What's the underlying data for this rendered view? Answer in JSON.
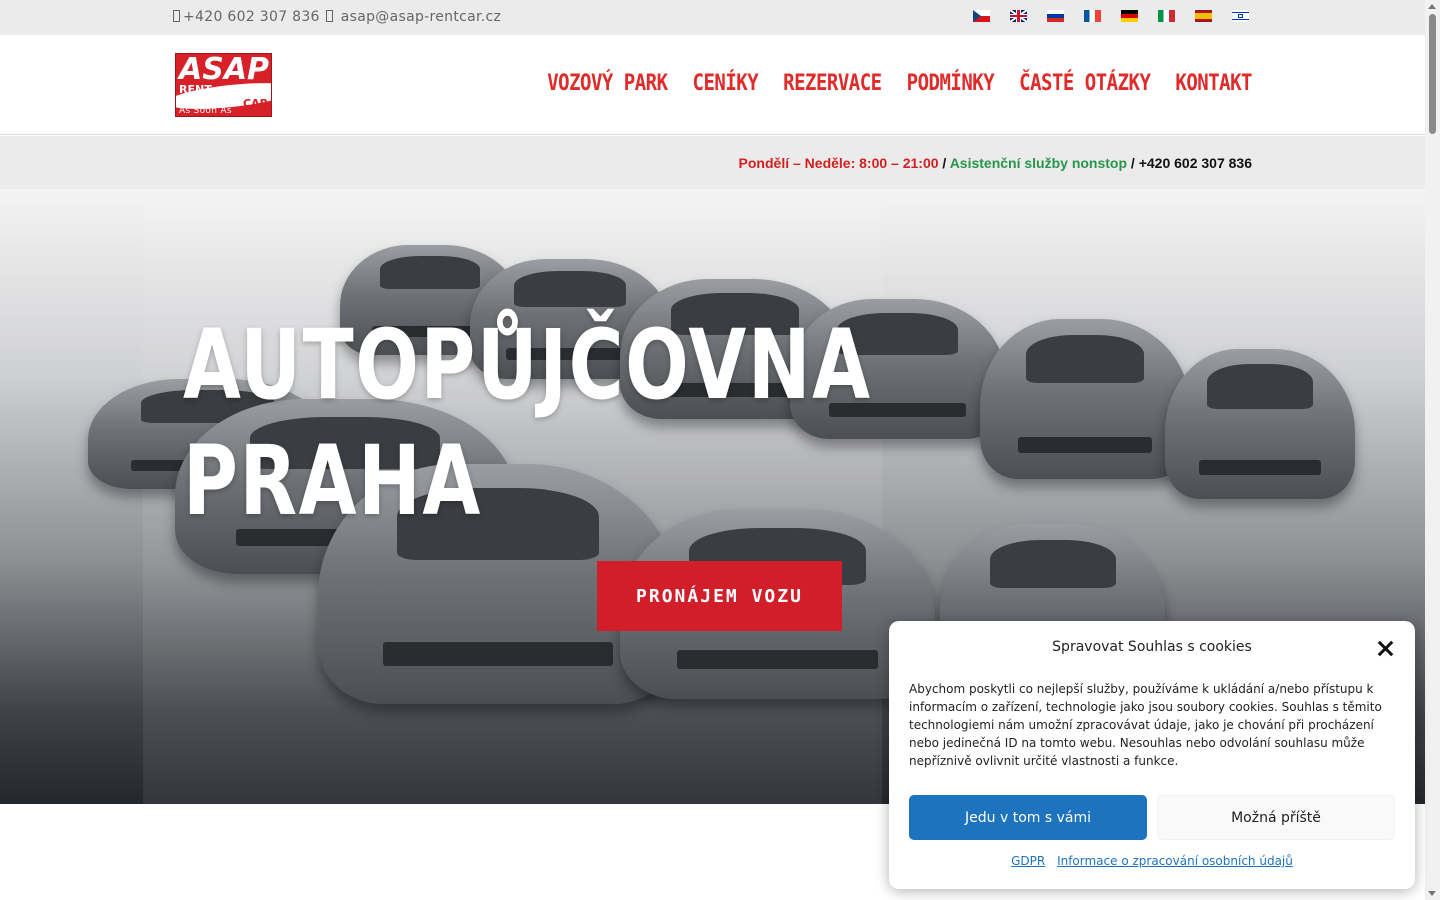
{
  "topbar": {
    "phone": "+420 602 307 836",
    "email": "asap@asap-rentcar.cz",
    "flags": [
      "cz",
      "gb",
      "ru",
      "fr",
      "de",
      "it",
      "es",
      "il"
    ]
  },
  "logo": {
    "big": "ASAP",
    "rent": "RENT",
    "car": "CAR",
    "tagline": "As Soon As Possible"
  },
  "nav": [
    "VOZOVÝ PARK",
    "CENÍKY",
    "REZERVACE",
    "PODMÍNKY",
    "ČASTÉ OTÁZKY",
    "KONTAKT"
  ],
  "hours": {
    "opening": "Pondělí – Neděle: 8:00 – 21:00",
    "sep": " / ",
    "assistance": "Asistenční služby nonstop",
    "phone": " / +420 602 307 836"
  },
  "hero": {
    "title_line1": "AUTOPŮJČOVNA",
    "title_line2": "PRAHA",
    "cta": "PRONÁJEM VOZU"
  },
  "cookie": {
    "title": "Spravovat Souhlas s cookies",
    "body": "Abychom poskytli co nejlepší služby, používáme k ukládání a/nebo přístupu k informacím o zařízení, technologie jako jsou soubory cookies. Souhlas s těmito technologiemi nám umožní zpracovávat údaje, jako je chování při procházení nebo jedinečná ID na tomto webu. Nesouhlas nebo odvolání souhlasu může nepříznivě ovlivnit určité vlastnosti a funkce.",
    "accept": "Jedu v tom s vámi",
    "deny": "Možná příště",
    "link1": "GDPR",
    "link2": "Informace o zpracování osobních údajů"
  },
  "colors": {
    "brand_red": "#e02b2b",
    "cta_red": "#d21e29",
    "assist_green": "#27954a",
    "accept_blue": "#1e73be"
  }
}
